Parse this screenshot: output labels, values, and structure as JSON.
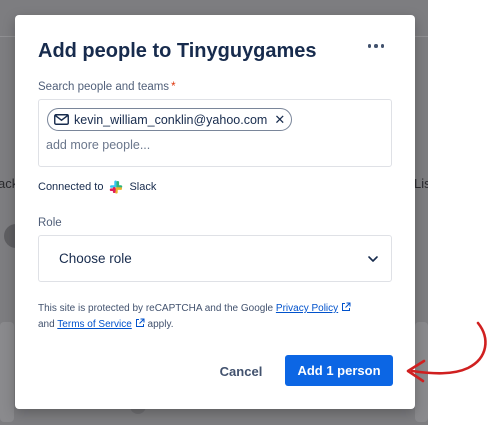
{
  "background": {
    "left_fragment": "ack",
    "right_fragment": "Lis"
  },
  "modal": {
    "title": "Add people to Tinyguygames",
    "more_icon": "more-horizontal-icon",
    "search": {
      "label": "Search people and teams",
      "required_marker": "*",
      "chip_email": "kevin_william_conklin@yahoo.com",
      "chip_icon": "mail-icon",
      "remove_glyph": "✕",
      "placeholder": "add more people..."
    },
    "connected": {
      "label": "Connected to",
      "service": "Slack",
      "icon": "slack-icon"
    },
    "role": {
      "label": "Role",
      "value": "Choose role",
      "icon": "chevron-down-icon"
    },
    "recaptcha": {
      "prefix": "This site is protected by reCAPTCHA and the Google",
      "privacy_link": "Privacy Policy",
      "and": "and",
      "terms_link": "Terms of Service",
      "suffix": "apply."
    },
    "buttons": {
      "cancel": "Cancel",
      "add": "Add 1 person"
    }
  },
  "colors": {
    "primary": "#0c66e4",
    "required": "#de350b",
    "link": "#0052cc",
    "annotation": "#d02020",
    "backdrop": "#7d7d80"
  }
}
